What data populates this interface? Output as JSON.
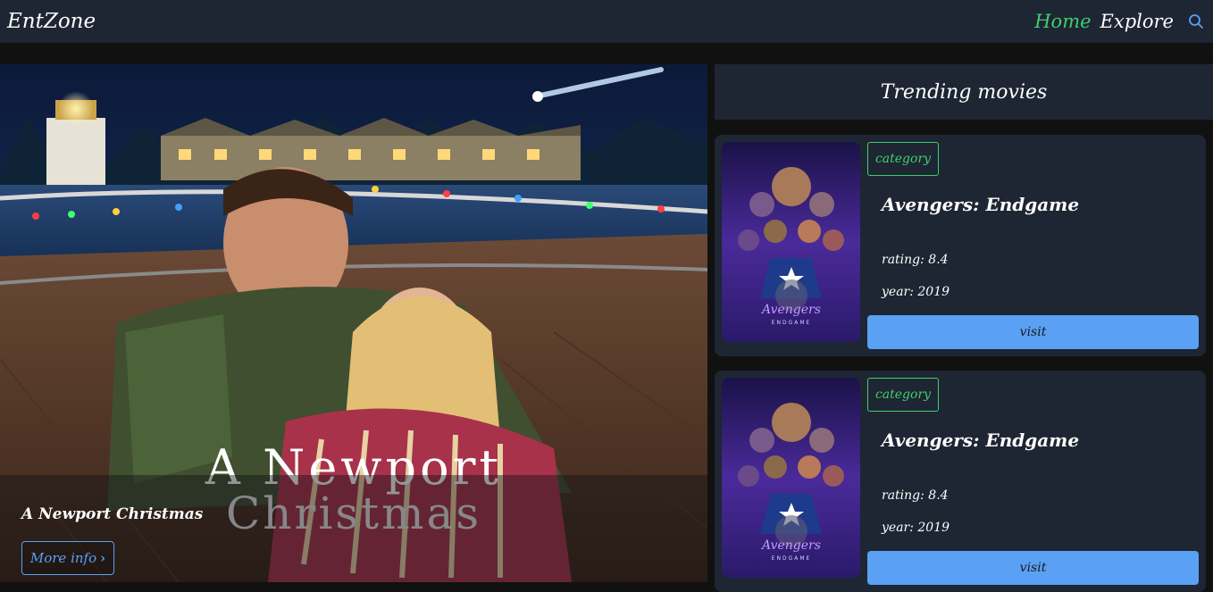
{
  "nav": {
    "brand": "EntZone",
    "home": "Home",
    "explore": "Explore",
    "search_icon": "search-icon",
    "accent_active": "#3ecf6e",
    "accent_icon": "#5aa0f5"
  },
  "hero": {
    "poster_title_line1": "A Newport",
    "poster_title_line2": "Christmas",
    "title": "A Newport Christmas",
    "more_info": "More info",
    "more_info_icon": "chevron-right-icon"
  },
  "trending": {
    "heading": "Trending movies",
    "cards": [
      {
        "category": "category",
        "title": "Avengers: Endgame",
        "rating": "rating: 8.4",
        "year": "year: 2019",
        "visit": "visit",
        "poster_logo": "Avengers",
        "poster_sub": "ENDGAME"
      },
      {
        "category": "category",
        "title": "Avengers: Endgame",
        "rating": "rating: 8.4",
        "year": "year: 2019",
        "visit": "visit",
        "poster_logo": "Avengers",
        "poster_sub": "ENDGAME"
      }
    ]
  },
  "colors": {
    "navbar_bg": "#1e2533",
    "page_bg": "#111111",
    "button_blue": "#5aa0f5",
    "badge_green": "#3ecf6e"
  }
}
